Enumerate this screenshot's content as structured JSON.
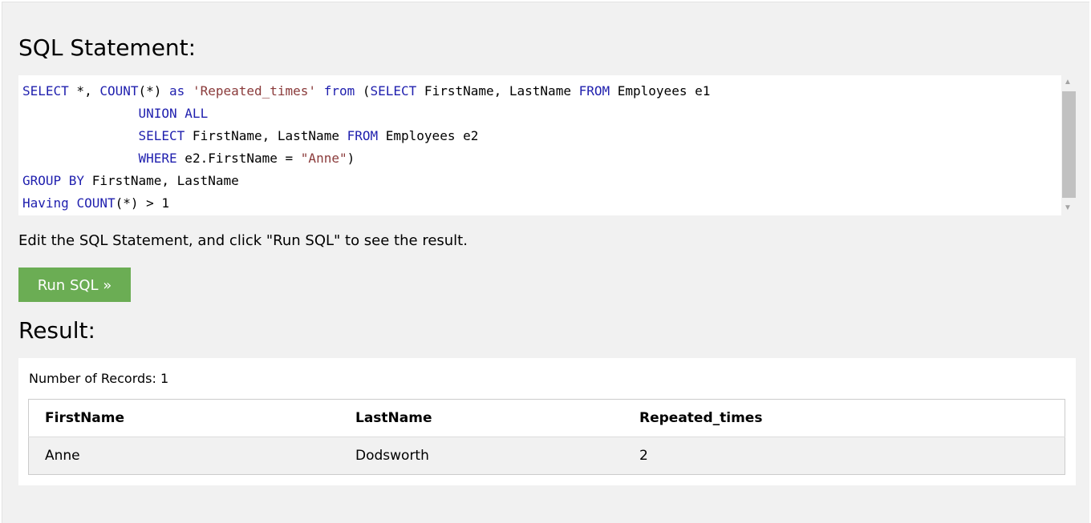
{
  "sql_title": "SQL Statement:",
  "sql": {
    "line1": {
      "k1": "SELECT",
      "t1": " *, ",
      "k2": "COUNT",
      "t2": "(*) ",
      "k3": "as",
      "t3": " ",
      "s1": "'Repeated_times'",
      "t4": " ",
      "k4": "from",
      "t5": " (",
      "k5": "SELECT",
      "t6": " FirstName, LastName ",
      "k6": "FROM",
      "t7": " Employees e1"
    },
    "line2": {
      "indent": "               ",
      "k1": "UNION ALL"
    },
    "line3": {
      "indent": "               ",
      "k1": "SELECT",
      "t1": " FirstName, LastName ",
      "k2": "FROM",
      "t2": " Employees e2"
    },
    "line4": {
      "indent": "               ",
      "k1": "WHERE",
      "t1": " e2.FirstName = ",
      "s1": "\"Anne\"",
      "t2": ")"
    },
    "line5": {
      "k1": "GROUP BY",
      "t1": " FirstName, LastName"
    },
    "line6": {
      "k1": "Having",
      "t1": " ",
      "k2": "COUNT",
      "t2": "(*) > 1"
    }
  },
  "hint": "Edit the SQL Statement, and click \"Run SQL\" to see the result.",
  "run_button": "Run SQL »",
  "result_title": "Result:",
  "records": "Number of Records: 1",
  "table": {
    "headers": [
      "FirstName",
      "LastName",
      "Repeated_times"
    ],
    "rows": [
      [
        "Anne",
        "Dodsworth",
        "2"
      ]
    ]
  },
  "colors": {
    "keyword": "#1f1fae",
    "string": "#8a3a3a",
    "button": "#6bad54"
  }
}
